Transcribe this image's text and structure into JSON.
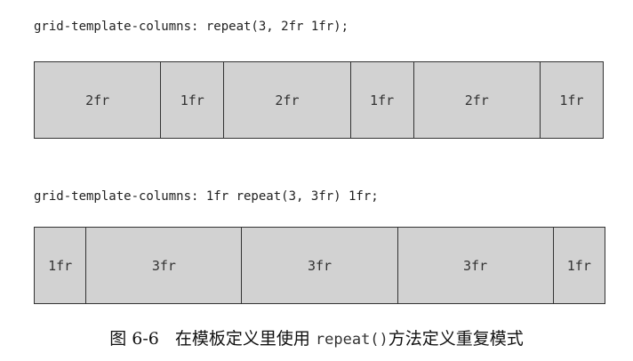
{
  "example1": {
    "code": "grid-template-columns: repeat(3, 2fr 1fr);",
    "cells": [
      "2fr",
      "1fr",
      "2fr",
      "1fr",
      "2fr",
      "1fr"
    ]
  },
  "example2": {
    "code": "grid-template-columns: 1fr repeat(3, 3fr) 1fr;",
    "cells": [
      "1fr",
      "3fr",
      "3fr",
      "3fr",
      "1fr"
    ]
  },
  "caption": {
    "number": "图 6-6",
    "text_before": "在模板定义里使用 ",
    "code": "repeat()",
    "text_after": "方法定义重复模式"
  },
  "colors": {
    "cell_fill": "#d2d2d2",
    "border": "#333333"
  }
}
